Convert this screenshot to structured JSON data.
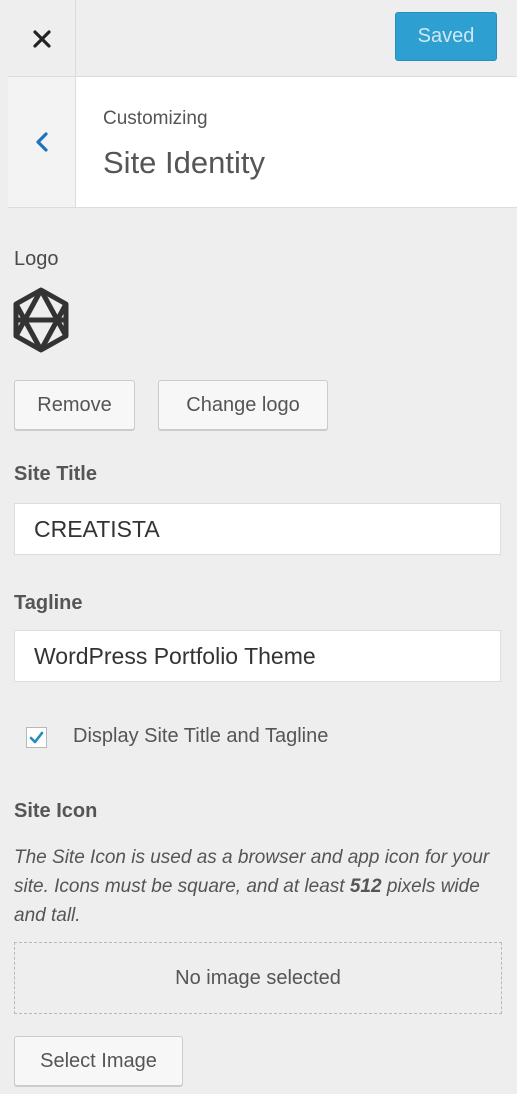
{
  "header": {
    "close_glyph": "✕",
    "saved_label": "Saved",
    "accent_color": "#2e9fd1"
  },
  "titlebar": {
    "breadcrumb": "Customizing",
    "title": "Site Identity",
    "back_icon": "chevron-left-icon"
  },
  "logo": {
    "label": "Logo",
    "remove_label": "Remove",
    "change_label": "Change logo"
  },
  "site_title": {
    "label": "Site Title",
    "value": "CREATISTA"
  },
  "tagline": {
    "label": "Tagline",
    "value": "WordPress Portfolio Theme"
  },
  "display_toggle": {
    "label": "Display Site Title and Tagline",
    "checked": true
  },
  "site_icon": {
    "label": "Site Icon",
    "desc_before": "The Site Icon is used as a browser and app icon for your site. Icons must be square, and at least ",
    "desc_bold": "512",
    "desc_after": " pixels wide and tall.",
    "empty_text": "No image selected",
    "select_label": "Select Image"
  }
}
